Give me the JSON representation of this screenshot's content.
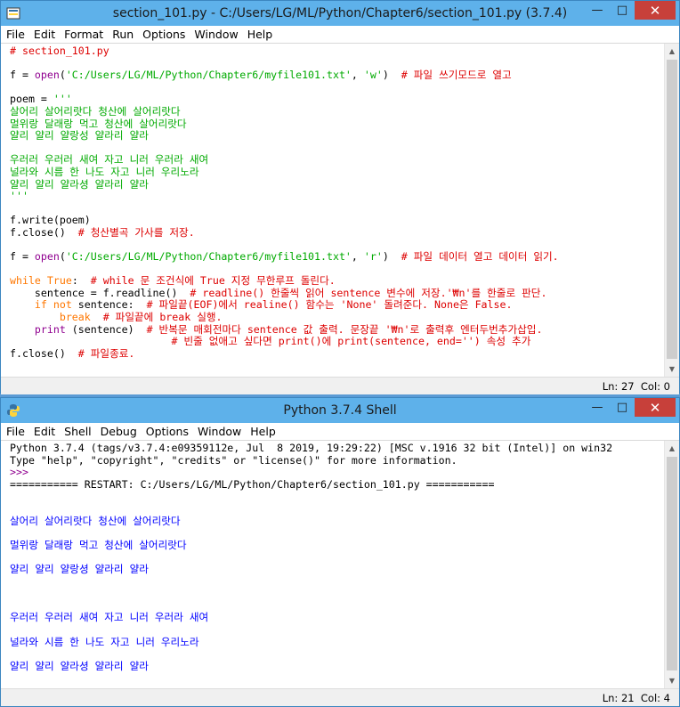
{
  "editor": {
    "title": "section_101.py - C:/Users/LG/ML/Python/Chapter6/section_101.py (3.7.4)",
    "menu": [
      "File",
      "Edit",
      "Format",
      "Run",
      "Options",
      "Window",
      "Help"
    ],
    "status": "Ln: 27  Col: 0",
    "lines": [
      [
        [
          "c",
          "# section_101.py"
        ]
      ],
      [],
      [
        [
          "d",
          "f = "
        ],
        [
          "b",
          "open"
        ],
        [
          "d",
          "("
        ],
        [
          "s",
          "'C:/Users/LG/ML/Python/Chapter6/myfile101.txt'"
        ],
        [
          "d",
          ", "
        ],
        [
          "s",
          "'w'"
        ],
        [
          "d",
          ")  "
        ],
        [
          "c",
          "# 파일 쓰기모드로 열고"
        ]
      ],
      [],
      [
        [
          "d",
          "poem = "
        ],
        [
          "s",
          "'''"
        ]
      ],
      [
        [
          "s",
          "살어리 살어리랏다 청산에 살어리랏다"
        ]
      ],
      [
        [
          "s",
          "멀위랑 달래랑 먹고 청산에 살어리랏다"
        ]
      ],
      [
        [
          "s",
          "얄리 얄리 얄랑성 얄라리 얄라"
        ]
      ],
      [],
      [
        [
          "s",
          "우러러 우러러 새여 자고 니러 우러라 새여"
        ]
      ],
      [
        [
          "s",
          "널라와 시름 한 나도 자고 니러 우리노라"
        ]
      ],
      [
        [
          "s",
          "얄리 얄리 얄라셩 얄라리 얄라"
        ]
      ],
      [
        [
          "s",
          "'''"
        ]
      ],
      [],
      [
        [
          "d",
          "f.write(poem)"
        ]
      ],
      [
        [
          "d",
          "f.close()  "
        ],
        [
          "c",
          "# 청산별곡 가사를 저장."
        ]
      ],
      [],
      [
        [
          "d",
          "f = "
        ],
        [
          "b",
          "open"
        ],
        [
          "d",
          "("
        ],
        [
          "s",
          "'C:/Users/LG/ML/Python/Chapter6/myfile101.txt'"
        ],
        [
          "d",
          ", "
        ],
        [
          "s",
          "'r'"
        ],
        [
          "d",
          ")  "
        ],
        [
          "c",
          "# 파일 데이터 열고 데이터 읽기."
        ]
      ],
      [],
      [
        [
          "k",
          "while"
        ],
        [
          "d",
          " "
        ],
        [
          "k",
          "True"
        ],
        [
          "d",
          ":  "
        ],
        [
          "c",
          "# while 문 조건식에 True 지정 무한루프 돌린다."
        ]
      ],
      [
        [
          "d",
          "    sentence = f.readline()  "
        ],
        [
          "c",
          "# readline() 한줄씩 읽어 sentence 변수에 저장.'₩n'를 한줄로 판단."
        ]
      ],
      [
        [
          "d",
          "    "
        ],
        [
          "k",
          "if not"
        ],
        [
          "d",
          " sentence:  "
        ],
        [
          "c",
          "# 파일끝(EOF)에서 realine() 함수는 'None' 돌려준다. None은 False."
        ]
      ],
      [
        [
          "d",
          "        "
        ],
        [
          "k",
          "break"
        ],
        [
          "d",
          "  "
        ],
        [
          "c",
          "# 파일끝에 break 실행."
        ]
      ],
      [
        [
          "d",
          "    "
        ],
        [
          "b",
          "print"
        ],
        [
          "d",
          " (sentence)  "
        ],
        [
          "c",
          "# 반복문 매회전마다 sentence 값 출력. 문장끝 '₩n'로 출력후 엔터두번추가삽입."
        ]
      ],
      [
        [
          "d",
          "                          "
        ],
        [
          "c",
          "# 빈줄 없애고 싶다면 print()에 print(sentence, end='') 속성 추가"
        ]
      ],
      [
        [
          "d",
          "f.close()  "
        ],
        [
          "c",
          "# 파일종료."
        ]
      ]
    ]
  },
  "shell": {
    "title": "Python 3.7.4 Shell",
    "menu": [
      "File",
      "Edit",
      "Shell",
      "Debug",
      "Options",
      "Window",
      "Help"
    ],
    "status": "Ln: 21  Col: 4",
    "lines": [
      [
        [
          "d",
          "Python 3.7.4 (tags/v3.7.4:e09359112e, Jul  8 2019, 19:29:22) [MSC v.1916 32 bit (Intel)] on win32"
        ]
      ],
      [
        [
          "d",
          "Type \"help\", \"copyright\", \"credits\" or \"license()\" for more information."
        ]
      ],
      [
        [
          "p",
          ">>> "
        ]
      ],
      [
        [
          "d",
          "=========== RESTART: C:/Users/LG/ML/Python/Chapter6/section_101.py ==========="
        ]
      ],
      [],
      [],
      [
        [
          "o",
          "살어리 살어리랏다 청산에 살어리랏다"
        ]
      ],
      [],
      [
        [
          "o",
          "멀위랑 달래랑 먹고 청산에 살어리랏다"
        ]
      ],
      [],
      [
        [
          "o",
          "얄리 얄리 얄랑셩 얄라리 얄라"
        ]
      ],
      [],
      [],
      [],
      [
        [
          "o",
          "우러러 우러러 새여 자고 니러 우러라 새여"
        ]
      ],
      [],
      [
        [
          "o",
          "널라와 시름 한 나도 자고 니러 우리노라"
        ]
      ],
      [],
      [
        [
          "o",
          "얄리 얄리 얄라셩 얄라리 얄라"
        ]
      ]
    ]
  },
  "colors": {
    "comment": "#dd0000",
    "keyword": "#ff7700",
    "builtin": "#900090",
    "string": "#00aa00",
    "default": "#000000",
    "output": "#0000ff",
    "prompt": "#900090"
  },
  "icons": {
    "app": "python-idle-icon",
    "minimize": "minimize-icon",
    "maximize": "maximize-icon",
    "close": "close-icon"
  }
}
